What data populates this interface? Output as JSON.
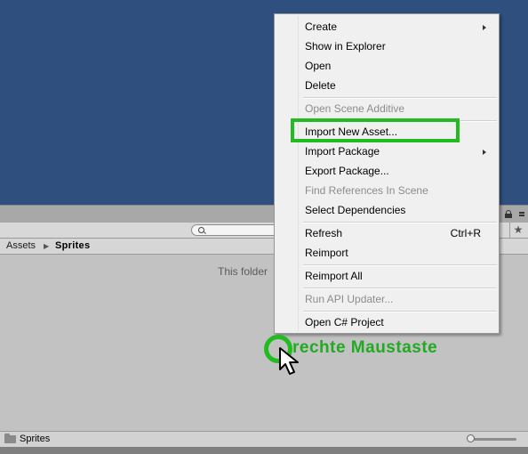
{
  "scene_view": {},
  "project_panel": {
    "breadcrumb": {
      "root": "Assets",
      "current": "Sprites"
    },
    "empty_message": "This folder",
    "status_bar": {
      "selected_path": "Sprites",
      "zoom_fraction": 0.0
    },
    "star_glyph": "★"
  },
  "context_menu": {
    "items": [
      {
        "label": "Create",
        "enabled": true,
        "submenu": true
      },
      {
        "label": "Show in Explorer",
        "enabled": true
      },
      {
        "label": "Open",
        "enabled": true
      },
      {
        "label": "Delete",
        "enabled": true
      },
      {
        "label": "Open Scene Additive",
        "enabled": false
      },
      {
        "label": "Import New Asset...",
        "enabled": true,
        "highlighted": true
      },
      {
        "label": "Import Package",
        "enabled": true,
        "submenu": true
      },
      {
        "label": "Export Package...",
        "enabled": true
      },
      {
        "label": "Find References In Scene",
        "enabled": false
      },
      {
        "label": "Select Dependencies",
        "enabled": true
      },
      {
        "label": "Refresh",
        "enabled": true,
        "shortcut": "Ctrl+R"
      },
      {
        "label": "Reimport",
        "enabled": true
      },
      {
        "label": "Reimport All",
        "enabled": true
      },
      {
        "label": "Run API Updater...",
        "enabled": false
      },
      {
        "label": "Open C# Project",
        "enabled": true
      }
    ]
  },
  "annotation": {
    "text": "rechte Maustaste",
    "color": "#22bb22"
  },
  "colors": {
    "scene_background": "#2f4f7f",
    "panel_background": "#c2c2c2",
    "menu_background": "#f0f0f0",
    "highlight": "#22bb22"
  }
}
